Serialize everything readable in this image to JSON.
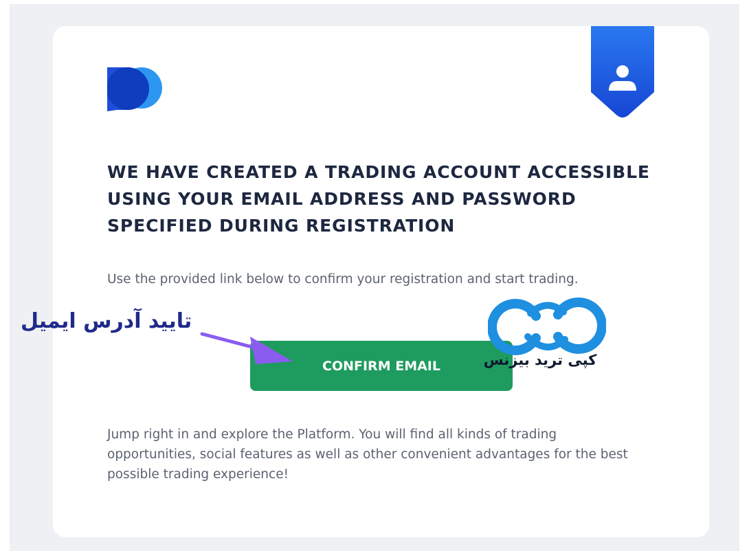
{
  "email": {
    "headline": "WE HAVE CREATED A TRADING ACCOUNT ACCESSIBLE USING YOUR EMAIL ADDRESS AND PASSWORD SPECIFIED DURING REGISTRATION",
    "intro": "Use the provided link below to confirm your registration and start trading.",
    "confirm_button_label": "CONFIRM EMAIL",
    "outro": "Jump right in and explore the Platform. You will find all kinds of trading opportunities, social features as well as other convenient advantages for the best possible trading experience!"
  },
  "annotation": {
    "label": "تایید آدرس ایمیل",
    "arrow_icon": "arrow-right-icon"
  },
  "watermark": {
    "text": "کپی ترید بیزنس",
    "icon": "infinity-cc-logo-icon"
  },
  "icons": {
    "brand_logo": "po-logo-icon",
    "ribbon": "user-icon"
  },
  "colors": {
    "page_background": "#eef0f3",
    "card_background": "#ffffff",
    "headline_text": "#1d2740",
    "body_text": "#5b6270",
    "button_green": "#1e9b5e",
    "brand_blue": "#1a5ae6",
    "annotation_text": "#1f2a8a",
    "arrow_purple": "#8a5cf0",
    "watermark_blue": "#1f8fe0"
  }
}
